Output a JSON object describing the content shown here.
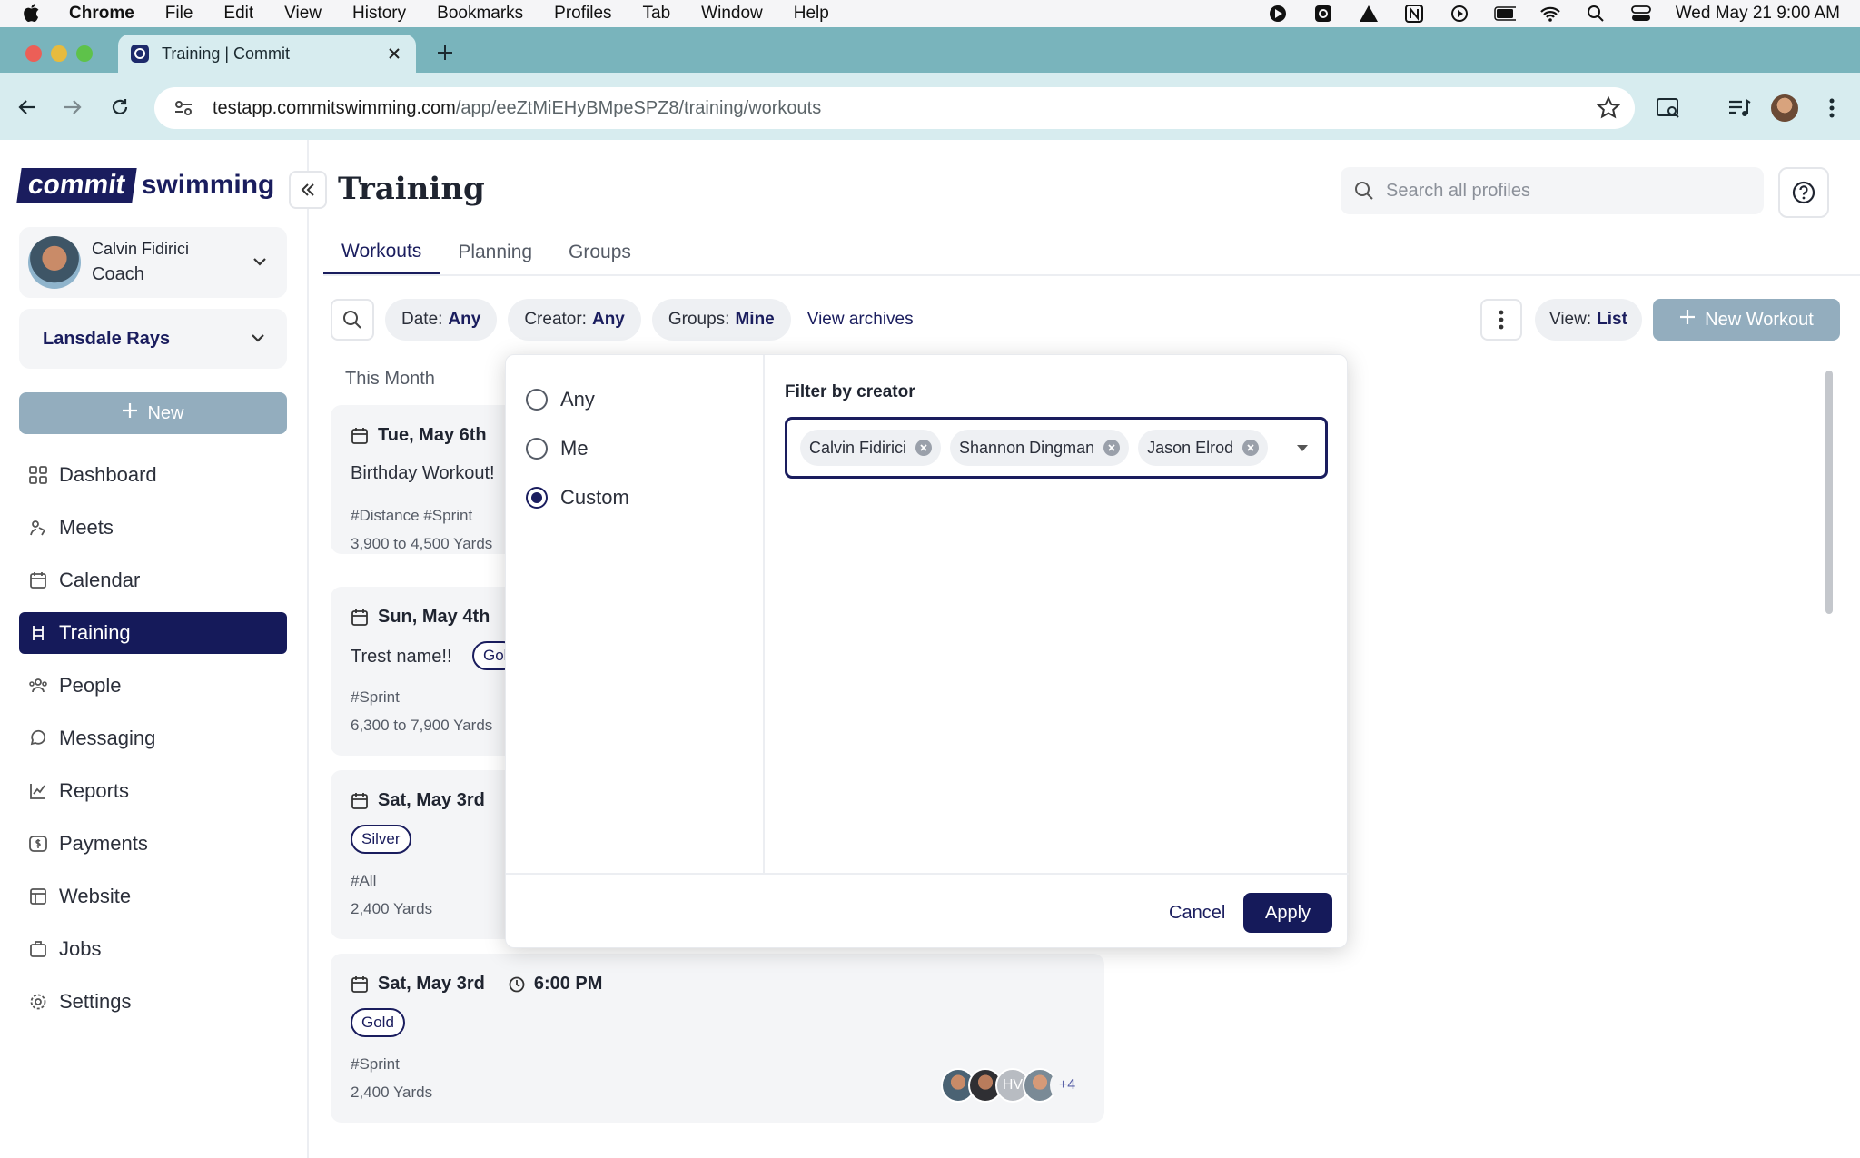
{
  "menubar": {
    "app": "Chrome",
    "items": [
      "File",
      "Edit",
      "View",
      "History",
      "Bookmarks",
      "Profiles",
      "Tab",
      "Window",
      "Help"
    ],
    "clock": "Wed May 21  9:00 AM"
  },
  "browser": {
    "tab_title": "Training | Commit",
    "url_host": "testapp.commitswimming.com",
    "url_path": "/app/eeZtMiEHyBMpeSPZ8/training/workouts"
  },
  "sidebar": {
    "logo_box": "commit",
    "logo_rest": "swimming",
    "user": {
      "name": "Calvin Fidirici",
      "role": "Coach"
    },
    "team": "Lansdale Rays",
    "new_label": "New",
    "items": [
      {
        "label": "Dashboard",
        "icon": "grid-icon"
      },
      {
        "label": "Meets",
        "icon": "meets-icon"
      },
      {
        "label": "Calendar",
        "icon": "calendar-icon"
      },
      {
        "label": "Training",
        "icon": "training-icon",
        "active": true
      },
      {
        "label": "People",
        "icon": "people-icon"
      },
      {
        "label": "Messaging",
        "icon": "chat-icon"
      },
      {
        "label": "Reports",
        "icon": "chart-icon"
      },
      {
        "label": "Payments",
        "icon": "dollar-icon"
      },
      {
        "label": "Website",
        "icon": "website-icon"
      },
      {
        "label": "Jobs",
        "icon": "briefcase-icon"
      },
      {
        "label": "Settings",
        "icon": "gear-icon"
      }
    ]
  },
  "header": {
    "title": "Training",
    "search_placeholder": "Search all profiles"
  },
  "tabs": [
    "Workouts",
    "Planning",
    "Groups"
  ],
  "filters": {
    "date_label": "Date:",
    "date_value": "Any",
    "creator_label": "Creator:",
    "creator_value": "Any",
    "groups_label": "Groups:",
    "groups_value": "Mine",
    "archives_link": "View archives",
    "view_label": "View:",
    "view_value": "List",
    "new_workout": "New Workout"
  },
  "section_label": "This Month",
  "workouts": [
    {
      "date": "Tue, May 6th",
      "name": "Birthday Workout!",
      "tags": "#Distance #Sprint",
      "yards": "3,900 to 4,500 Yards"
    },
    {
      "date": "Sun, May 4th",
      "name": "Trest name!!",
      "badge": "Gol",
      "tags": "#Sprint",
      "yards": "6,300 to 7,900 Yards"
    },
    {
      "date": "Sat, May 3rd",
      "badge": "Silver",
      "tags": "#All",
      "yards": "2,400 Yards"
    },
    {
      "date": "Sat, May 3rd",
      "time": "6:00 PM",
      "badge": "Gold",
      "tags": "#Sprint",
      "yards": "2,400 Yards",
      "avatar_initials": "HV",
      "avatar_more": "+4"
    }
  ],
  "popover": {
    "options": [
      "Any",
      "Me",
      "Custom"
    ],
    "selected": "Custom",
    "title": "Filter by creator",
    "chips": [
      "Calvin Fidirici",
      "Shannon Dingman",
      "Jason Elrod"
    ],
    "cancel": "Cancel",
    "apply": "Apply"
  },
  "colors": {
    "navy": "#151a5a",
    "teal_chrome": "#79b4bc",
    "muted_button": "#93adbe"
  }
}
